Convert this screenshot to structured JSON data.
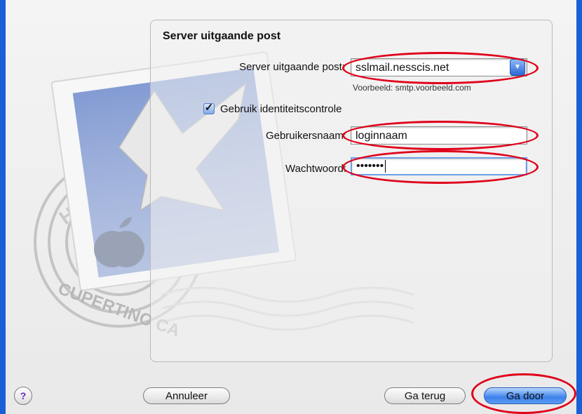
{
  "section": {
    "title": "Server uitgaande post"
  },
  "smtp": {
    "label": "Server uitgaande post:",
    "value": "sslmail.nesscis.net",
    "hint": "Voorbeeld: smtp.voorbeeld.com"
  },
  "auth": {
    "checkbox_label": "Gebruik identiteitscontrole",
    "checked": true
  },
  "username": {
    "label": "Gebruikersnaam:",
    "value": "loginnaam"
  },
  "password": {
    "label": "Wachtwoord:",
    "value": "•••••••"
  },
  "buttons": {
    "help": "?",
    "cancel": "Annuleer",
    "back": "Ga terug",
    "continue": "Ga door"
  },
  "stamp": {
    "text_top": "HELLO FR",
    "text_bottom": "CUPERTINO CA"
  },
  "colors": {
    "desktop": "#1b5fd6",
    "highlight_oval": "#e0001a",
    "default_button": "#3d82ea"
  }
}
